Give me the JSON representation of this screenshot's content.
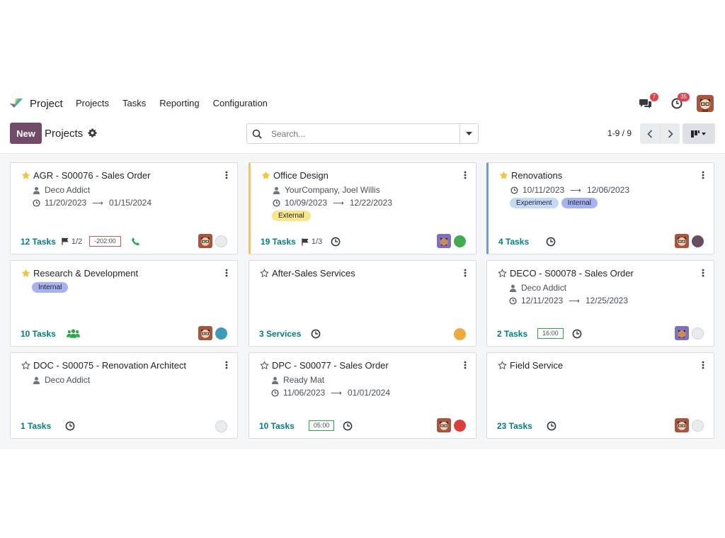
{
  "nav": {
    "app_name": "Project",
    "menu": [
      "Projects",
      "Tasks",
      "Reporting",
      "Configuration"
    ],
    "messages_count": "7",
    "activities_count": "35"
  },
  "control": {
    "new_label": "New",
    "title": "Projects",
    "search_placeholder": "Search...",
    "pager": "1-9 / 9"
  },
  "colors": {
    "brand": "#714b67",
    "tasks_link": "#017e84",
    "status_green": "#3eac4f",
    "status_red": "#dc3e3e",
    "status_orange": "#f2a93b",
    "status_teal": "#3a9db8",
    "status_purple": "#6b4a63"
  },
  "projects": [
    {
      "name": "AGR - S00076 - Sales Order",
      "favorite": true,
      "customer": "Deco Addict",
      "dates": {
        "start": "11/20/2023",
        "end": "01/15/2024"
      },
      "tags": [],
      "tasks": "12 Tasks",
      "milestone": "1/2",
      "time": "-202:00",
      "activity_icon": "phone-icon",
      "status": "none"
    },
    {
      "name": "Office Design",
      "favorite": true,
      "customer": "YourCompany, Joel Willis",
      "dates": {
        "start": "10/09/2023",
        "end": "12/22/2023"
      },
      "tags": [
        {
          "label": "External",
          "color": "#f8e58c"
        }
      ],
      "tasks": "19 Tasks",
      "milestone": "1/3",
      "activity_icon": "clock-icon",
      "status": "green"
    },
    {
      "name": "Renovations",
      "favorite": true,
      "dates": {
        "start": "10/11/2023",
        "end": "12/06/2023"
      },
      "tags": [
        {
          "label": "Experiment",
          "color": "#c3d9f5"
        },
        {
          "label": "Internal",
          "color": "#a7b3f0"
        }
      ],
      "tasks": "4 Tasks",
      "activity_icon": "clock-icon",
      "status": "purple"
    },
    {
      "name": "Research & Development",
      "favorite": true,
      "tags": [
        {
          "label": "Internal",
          "color": "#a7b3f0"
        }
      ],
      "tasks": "10 Tasks",
      "activity_icon": "users-icon",
      "status": "teal"
    },
    {
      "name": "After-Sales Services",
      "favorite": false,
      "tags": [],
      "tasks": "3 Services",
      "activity_icon": "clock-icon",
      "status": "orange"
    },
    {
      "name": "DECO - S00078 - Sales Order",
      "favorite": false,
      "customer": "Deco Addict",
      "dates": {
        "start": "12/11/2023",
        "end": "12/25/2023"
      },
      "tags": [],
      "tasks": "2 Tasks",
      "time": "16:00",
      "activity_icon": "clock-icon",
      "status": "none"
    },
    {
      "name": "DOC - S00075 - Renovation Architect",
      "favorite": false,
      "customer": "Deco Addict",
      "tags": [],
      "tasks": "1 Tasks",
      "activity_icon": "clock-icon",
      "status": "none"
    },
    {
      "name": "DPC - S00077 - Sales Order",
      "favorite": false,
      "customer": "Ready Mat",
      "dates": {
        "start": "11/06/2023",
        "end": "01/01/2024"
      },
      "tags": [],
      "tasks": "10 Tasks",
      "time": "05:00",
      "activity_icon": "clock-icon",
      "status": "red"
    },
    {
      "name": "Field Service",
      "favorite": false,
      "tags": [],
      "tasks": "23 Tasks",
      "activity_icon": "clock-icon",
      "status": "none"
    }
  ]
}
